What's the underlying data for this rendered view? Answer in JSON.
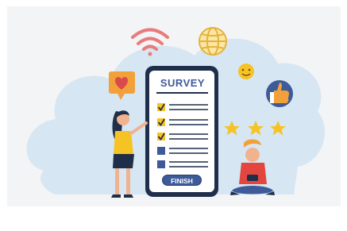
{
  "survey": {
    "title": "SURVEY",
    "finish_label": "FINISH",
    "items": [
      {
        "checked": true
      },
      {
        "checked": true
      },
      {
        "checked": true
      },
      {
        "checked": false
      },
      {
        "checked": false
      }
    ]
  },
  "rating": {
    "stars": 3
  },
  "icons": [
    "wifi-icon",
    "globe-icon",
    "smiley-icon",
    "thumbs-up-icon",
    "heart-icon",
    "star-icon",
    "checkbox-icon"
  ],
  "colors": {
    "background_panel": "#f3f4f6",
    "blob": "#d6e6f2",
    "phone_frame": "#1f2f4a",
    "accent_blue": "#3d5a99",
    "accent_orange": "#f2a13a",
    "star_yellow": "#f6c325",
    "wifi_red": "#ea7b7b"
  }
}
